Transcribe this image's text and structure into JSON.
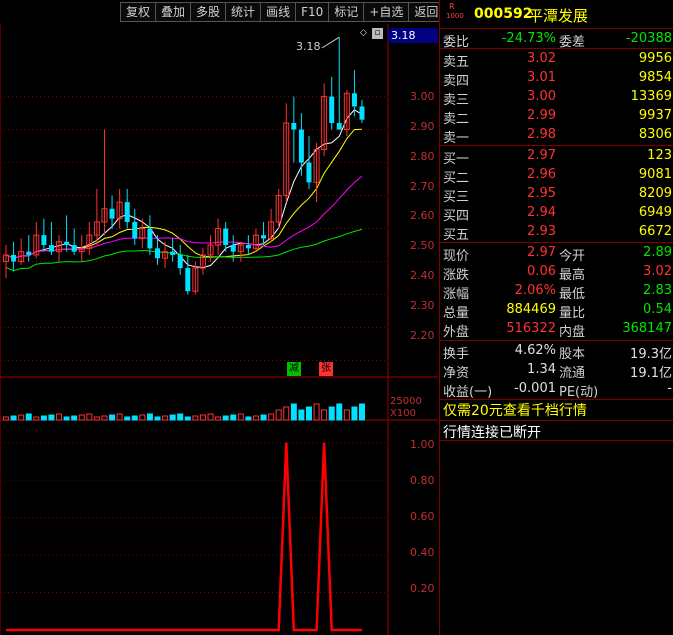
{
  "toolbar": {
    "buttons": [
      "复权",
      "叠加",
      "多股",
      "统计",
      "画线",
      "F10",
      "标记",
      "+自选",
      "返回"
    ]
  },
  "chart": {
    "current_price_tag": "3.18",
    "high_marker": "3.18",
    "price_axis": [
      "3.00",
      "2.90",
      "2.80",
      "2.70",
      "2.60",
      "2.50",
      "2.40",
      "2.30",
      "2.20"
    ],
    "volume_badges": [
      "减",
      "张"
    ],
    "volume_axis": [
      "25000",
      "X100"
    ],
    "indicator_axis": [
      "1.00",
      "0.80",
      "0.60",
      "0.40",
      "0.20"
    ],
    "colors": {
      "up": "#ff3232",
      "down": "#00e0ff",
      "ma5": "#ffffff",
      "ma10": "#ffff00",
      "ma20": "#ff00ff",
      "ma60": "#00e600",
      "signal": "#ff0000"
    }
  },
  "chart_data": [
    {
      "type": "candlestick",
      "ylim": [
        2.15,
        3.22
      ],
      "candles": [
        {
          "o": 2.5,
          "h": 2.55,
          "l": 2.45,
          "c": 2.52
        },
        {
          "o": 2.52,
          "h": 2.56,
          "l": 2.47,
          "c": 2.5
        },
        {
          "o": 2.5,
          "h": 2.57,
          "l": 2.49,
          "c": 2.53
        },
        {
          "o": 2.53,
          "h": 2.58,
          "l": 2.5,
          "c": 2.52
        },
        {
          "o": 2.52,
          "h": 2.62,
          "l": 2.51,
          "c": 2.58
        },
        {
          "o": 2.58,
          "h": 2.63,
          "l": 2.53,
          "c": 2.55
        },
        {
          "o": 2.55,
          "h": 2.62,
          "l": 2.52,
          "c": 2.53
        },
        {
          "o": 2.53,
          "h": 2.58,
          "l": 2.5,
          "c": 2.56
        },
        {
          "o": 2.56,
          "h": 2.64,
          "l": 2.53,
          "c": 2.55
        },
        {
          "o": 2.55,
          "h": 2.6,
          "l": 2.52,
          "c": 2.53
        },
        {
          "o": 2.53,
          "h": 2.58,
          "l": 2.5,
          "c": 2.54
        },
        {
          "o": 2.54,
          "h": 2.62,
          "l": 2.52,
          "c": 2.58
        },
        {
          "o": 2.58,
          "h": 2.72,
          "l": 2.55,
          "c": 2.62
        },
        {
          "o": 2.62,
          "h": 2.9,
          "l": 2.58,
          "c": 2.66
        },
        {
          "o": 2.66,
          "h": 2.7,
          "l": 2.6,
          "c": 2.63
        },
        {
          "o": 2.63,
          "h": 2.72,
          "l": 2.6,
          "c": 2.68
        },
        {
          "o": 2.68,
          "h": 2.72,
          "l": 2.6,
          "c": 2.62
        },
        {
          "o": 2.62,
          "h": 2.66,
          "l": 2.55,
          "c": 2.57
        },
        {
          "o": 2.57,
          "h": 2.63,
          "l": 2.54,
          "c": 2.6
        },
        {
          "o": 2.6,
          "h": 2.64,
          "l": 2.52,
          "c": 2.54
        },
        {
          "o": 2.54,
          "h": 2.58,
          "l": 2.49,
          "c": 2.51
        },
        {
          "o": 2.51,
          "h": 2.56,
          "l": 2.48,
          "c": 2.53
        },
        {
          "o": 2.53,
          "h": 2.57,
          "l": 2.5,
          "c": 2.52
        },
        {
          "o": 2.52,
          "h": 2.55,
          "l": 2.46,
          "c": 2.48
        },
        {
          "o": 2.48,
          "h": 2.52,
          "l": 2.4,
          "c": 2.41
        },
        {
          "o": 2.41,
          "h": 2.5,
          "l": 2.4,
          "c": 2.48
        },
        {
          "o": 2.48,
          "h": 2.54,
          "l": 2.46,
          "c": 2.52
        },
        {
          "o": 2.52,
          "h": 2.58,
          "l": 2.5,
          "c": 2.55
        },
        {
          "o": 2.55,
          "h": 2.63,
          "l": 2.52,
          "c": 2.6
        },
        {
          "o": 2.6,
          "h": 2.62,
          "l": 2.53,
          "c": 2.55
        },
        {
          "o": 2.55,
          "h": 2.58,
          "l": 2.5,
          "c": 2.53
        },
        {
          "o": 2.53,
          "h": 2.56,
          "l": 2.5,
          "c": 2.55
        },
        {
          "o": 2.55,
          "h": 2.58,
          "l": 2.52,
          "c": 2.54
        },
        {
          "o": 2.54,
          "h": 2.6,
          "l": 2.53,
          "c": 2.58
        },
        {
          "o": 2.58,
          "h": 2.62,
          "l": 2.55,
          "c": 2.57
        },
        {
          "o": 2.57,
          "h": 2.66,
          "l": 2.56,
          "c": 2.62
        },
        {
          "o": 2.62,
          "h": 2.72,
          "l": 2.6,
          "c": 2.7
        },
        {
          "o": 2.7,
          "h": 2.98,
          "l": 2.68,
          "c": 2.92
        },
        {
          "o": 2.92,
          "h": 3.0,
          "l": 2.8,
          "c": 2.9
        },
        {
          "o": 2.9,
          "h": 2.95,
          "l": 2.76,
          "c": 2.8
        },
        {
          "o": 2.8,
          "h": 2.88,
          "l": 2.72,
          "c": 2.74
        },
        {
          "o": 2.74,
          "h": 2.86,
          "l": 2.68,
          "c": 2.84
        },
        {
          "o": 2.84,
          "h": 3.04,
          "l": 2.82,
          "c": 3.0
        },
        {
          "o": 3.0,
          "h": 3.06,
          "l": 2.9,
          "c": 2.92
        },
        {
          "o": 2.92,
          "h": 3.18,
          "l": 2.9,
          "c": 2.9
        },
        {
          "o": 2.9,
          "h": 3.02,
          "l": 2.88,
          "c": 3.01
        },
        {
          "o": 3.01,
          "h": 3.08,
          "l": 2.94,
          "c": 2.97
        },
        {
          "o": 2.97,
          "h": 2.99,
          "l": 2.92,
          "c": 2.93
        }
      ]
    },
    {
      "type": "line",
      "title": "",
      "ylim": [
        0,
        1.1
      ],
      "values": [
        0,
        0,
        0,
        0,
        0,
        0,
        0,
        0,
        0,
        0,
        0,
        0,
        0,
        0,
        0,
        0,
        0,
        0,
        0,
        0,
        0,
        0,
        0,
        0,
        0,
        0,
        0,
        0,
        0,
        0,
        0,
        0,
        0,
        0,
        0,
        0,
        0,
        1,
        0,
        0,
        0,
        0,
        1,
        0,
        0,
        0,
        0,
        0
      ]
    }
  ],
  "quote": {
    "code": "000592",
    "name": "平潭发展",
    "badge_top": "R",
    "badge_bottom": "1000",
    "webi_label": "委比",
    "webi_value": "-24.73%",
    "weicha_label": "委差",
    "weicha_value": "-20388",
    "sells": [
      {
        "label": "卖五",
        "price": "3.02",
        "vol": "9956"
      },
      {
        "label": "卖四",
        "price": "3.01",
        "vol": "9854"
      },
      {
        "label": "卖三",
        "price": "3.00",
        "vol": "13369"
      },
      {
        "label": "卖二",
        "price": "2.99",
        "vol": "9937"
      },
      {
        "label": "卖一",
        "price": "2.98",
        "vol": "8306"
      }
    ],
    "buys": [
      {
        "label": "买一",
        "price": "2.97",
        "vol": "123"
      },
      {
        "label": "买二",
        "price": "2.96",
        "vol": "9081"
      },
      {
        "label": "买三",
        "price": "2.95",
        "vol": "8209"
      },
      {
        "label": "买四",
        "price": "2.94",
        "vol": "6949"
      },
      {
        "label": "买五",
        "price": "2.93",
        "vol": "6672"
      }
    ],
    "stats": [
      {
        "l1": "现价",
        "v1": "2.97",
        "c1": "red",
        "l2": "今开",
        "v2": "2.89",
        "c2": "green"
      },
      {
        "l1": "涨跌",
        "v1": "0.06",
        "c1": "red",
        "l2": "最高",
        "v2": "3.02",
        "c2": "red"
      },
      {
        "l1": "涨幅",
        "v1": "2.06%",
        "c1": "red",
        "l2": "最低",
        "v2": "2.83",
        "c2": "green"
      },
      {
        "l1": "总量",
        "v1": "884469",
        "c1": "yellow",
        "l2": "量比",
        "v2": "0.54",
        "c2": "green"
      },
      {
        "l1": "外盘",
        "v1": "516322",
        "c1": "red",
        "l2": "内盘",
        "v2": "368147",
        "c2": "green"
      }
    ],
    "stats2": [
      {
        "l1": "换手",
        "v1": "4.62%",
        "l2": "股本",
        "v2": "19.3亿"
      },
      {
        "l1": "净资",
        "v1": "1.34",
        "l2": "流通",
        "v2": "19.1亿"
      },
      {
        "l1": "收益(一)",
        "v1": "-0.001",
        "l2": "PE(动)",
        "v2": "-"
      }
    ],
    "notice": "仅需20元查看千档行情",
    "status": "行情连接已断开"
  }
}
